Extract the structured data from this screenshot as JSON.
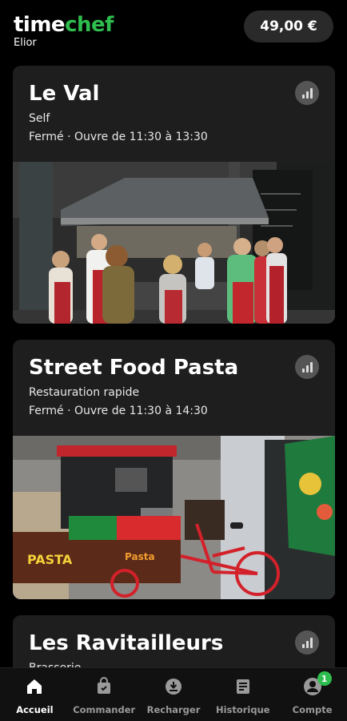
{
  "header": {
    "brand_time": "time",
    "brand_chef": "chef",
    "brand_sub": "Elior",
    "balance": "49,00 €"
  },
  "restaurants": [
    {
      "name": "Le Val",
      "type": "Self",
      "hours": "Fermé · Ouvre de 11:30 à 13:30"
    },
    {
      "name": "Street Food Pasta",
      "type": "Restauration rapide",
      "hours": "Fermé · Ouvre de 11:30 à 14:30"
    },
    {
      "name": "Les Ravitailleurs",
      "type": "Brasserie",
      "hours": ""
    }
  ],
  "photo_texts": {
    "pasta": "PASTA",
    "pasta_small": "Pasta"
  },
  "tabs": [
    {
      "label": "Accueil",
      "icon": "home-icon",
      "active": true
    },
    {
      "label": "Commander",
      "icon": "bag-icon",
      "active": false
    },
    {
      "label": "Recharger",
      "icon": "download-circle-icon",
      "active": false
    },
    {
      "label": "Historique",
      "icon": "document-icon",
      "active": false
    },
    {
      "label": "Compte",
      "icon": "account-icon",
      "active": false,
      "badge": "1"
    }
  ],
  "colors": {
    "brand_green": "#2ebd4e",
    "card_bg": "#1e1e1e",
    "background": "#000000"
  }
}
